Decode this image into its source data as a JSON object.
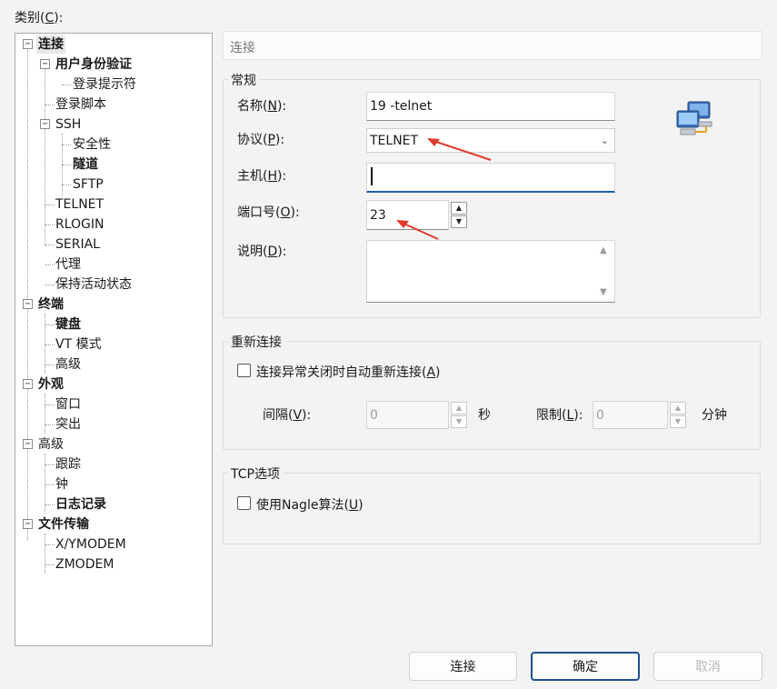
{
  "category_label": "类别(",
  "category_label_key": "C",
  "category_label_end": "):",
  "tree": [
    {
      "label": "连接",
      "bold": true,
      "selected": true
    },
    {
      "label": "用户身份验证",
      "bold": true
    },
    {
      "label": "登录提示符",
      "bold": false
    },
    {
      "label": "登录脚本",
      "bold": false
    },
    {
      "label": "SSH",
      "bold": false
    },
    {
      "label": "安全性",
      "bold": false
    },
    {
      "label": "隧道",
      "bold": true
    },
    {
      "label": "SFTP",
      "bold": false
    },
    {
      "label": "TELNET",
      "bold": false
    },
    {
      "label": "RLOGIN",
      "bold": false
    },
    {
      "label": "SERIAL",
      "bold": false
    },
    {
      "label": "代理",
      "bold": false
    },
    {
      "label": "保持活动状态",
      "bold": false
    },
    {
      "label": "终端",
      "bold": true
    },
    {
      "label": "键盘",
      "bold": true
    },
    {
      "label": "VT 模式",
      "bold": false
    },
    {
      "label": "高级",
      "bold": false
    },
    {
      "label": "外观",
      "bold": true
    },
    {
      "label": "窗口",
      "bold": false
    },
    {
      "label": "突出",
      "bold": false
    },
    {
      "label": "高级",
      "bold": false
    },
    {
      "label": "跟踪",
      "bold": false
    },
    {
      "label": "钟",
      "bold": false
    },
    {
      "label": "日志记录",
      "bold": true
    },
    {
      "label": "文件传输",
      "bold": true
    },
    {
      "label": "X/YMODEM",
      "bold": false
    },
    {
      "label": "ZMODEM",
      "bold": false
    }
  ],
  "header_title": "连接",
  "general": {
    "title": "常规",
    "name_label": "名称(",
    "name_key": "N",
    "name_end": "):",
    "name_value": "19 -telnet",
    "protocol_label": "协议(",
    "protocol_key": "P",
    "protocol_end": "):",
    "protocol_value": "TELNET",
    "host_label": "主机(",
    "host_key": "H",
    "host_end": "):",
    "host_value": "",
    "port_label": "端口号(",
    "port_key": "O",
    "port_end": "):",
    "port_value": "23",
    "desc_label": "说明(",
    "desc_key": "D",
    "desc_end": "):",
    "desc_value": ""
  },
  "reconnect": {
    "title": "重新连接",
    "checkbox_label": "连接异常关闭时自动重新连接(",
    "checkbox_key": "A",
    "checkbox_end": ")",
    "checked": false,
    "interval_label": "间隔(",
    "interval_key": "V",
    "interval_end": "):",
    "interval_value": "0",
    "interval_unit": "秒",
    "limit_label": "限制(",
    "limit_key": "L",
    "limit_end": "):",
    "limit_value": "0",
    "limit_unit": "分钟"
  },
  "tcp": {
    "title": "TCP选项",
    "checkbox_label": "使用Nagle算法(",
    "checkbox_key": "U",
    "checkbox_end": ")",
    "checked": false
  },
  "buttons": {
    "connect": "连接",
    "ok": "确定",
    "cancel": "取消"
  },
  "colors": {
    "accent": "#1f5fae",
    "arrow": "#e03a2f"
  }
}
